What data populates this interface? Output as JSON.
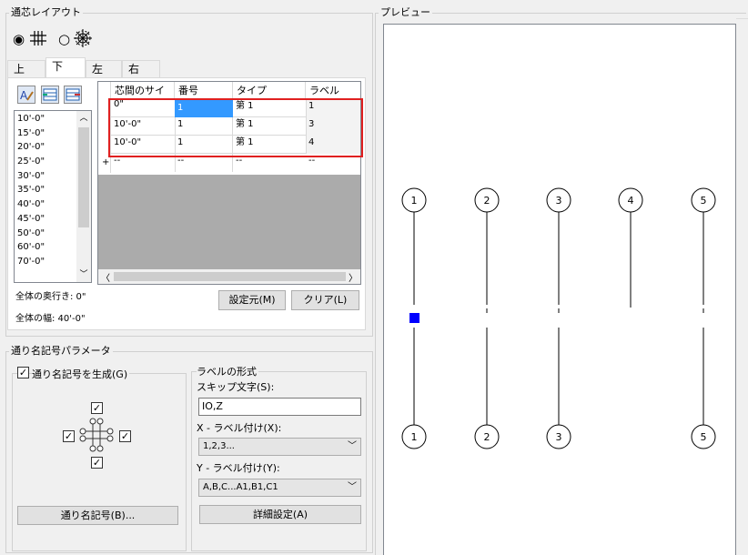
{
  "layout_group": {
    "title": "通芯レイアウト",
    "radio_grid": "◉",
    "radio_radial": "○",
    "tabs": [
      "上",
      "下",
      "左",
      "右"
    ],
    "active_tab": "下",
    "spacing_list": [
      "10'-0\"",
      "15'-0\"",
      "20'-0\"",
      "25'-0\"",
      "30'-0\"",
      "35'-0\"",
      "40'-0\"",
      "45'-0\"",
      "50'-0\"",
      "60'-0\"",
      "70'-0\""
    ],
    "grid_headers": [
      "芯間のサイ",
      "番号",
      "タイプ",
      "ラベル"
    ],
    "grid_rows": [
      {
        "spacing": "0\"",
        "number": "1",
        "type": "第 1",
        "label": "1"
      },
      {
        "spacing": "10'-0\"",
        "number": "1",
        "type": "第 1",
        "label": "3"
      },
      {
        "spacing": "10'-0\"",
        "number": "1",
        "type": "第 1",
        "label": "4"
      }
    ],
    "new_row_marker": "+",
    "new_row_cells": [
      "--",
      "--",
      "--",
      "--"
    ],
    "total_depth": "全体の奥行き: 0\"",
    "total_width": "全体の幅: 40'-0\"",
    "btn_set_origin": "設定元(M)",
    "btn_clear": "クリア(L)"
  },
  "bubble_group": {
    "title": "通り名記号パラメータ",
    "generate_label": "通り名記号を生成(G)",
    "generate_checked": "✓",
    "check_mark": "✓",
    "btn_bubbles": "通り名記号(B)...",
    "label_format_title": "ラベルの形式",
    "skip_chars_label": "スキップ文字(S):",
    "skip_chars_value": "IO,Z",
    "x_label": "X - ラベル付け(X):",
    "x_value": "1,2,3...",
    "y_label": "Y - ラベル付け(Y):",
    "y_value": "A,B,C...A1,B1,C1",
    "btn_advanced": "詳細設定(A)"
  },
  "preview": {
    "title": "プレビュー",
    "top_bubbles": [
      "1",
      "2",
      "3",
      "4",
      "5"
    ],
    "bottom_bubbles": [
      "1",
      "2",
      "3",
      "5"
    ],
    "highlight_color": "#e02020",
    "marker_color": "#0000ff"
  }
}
